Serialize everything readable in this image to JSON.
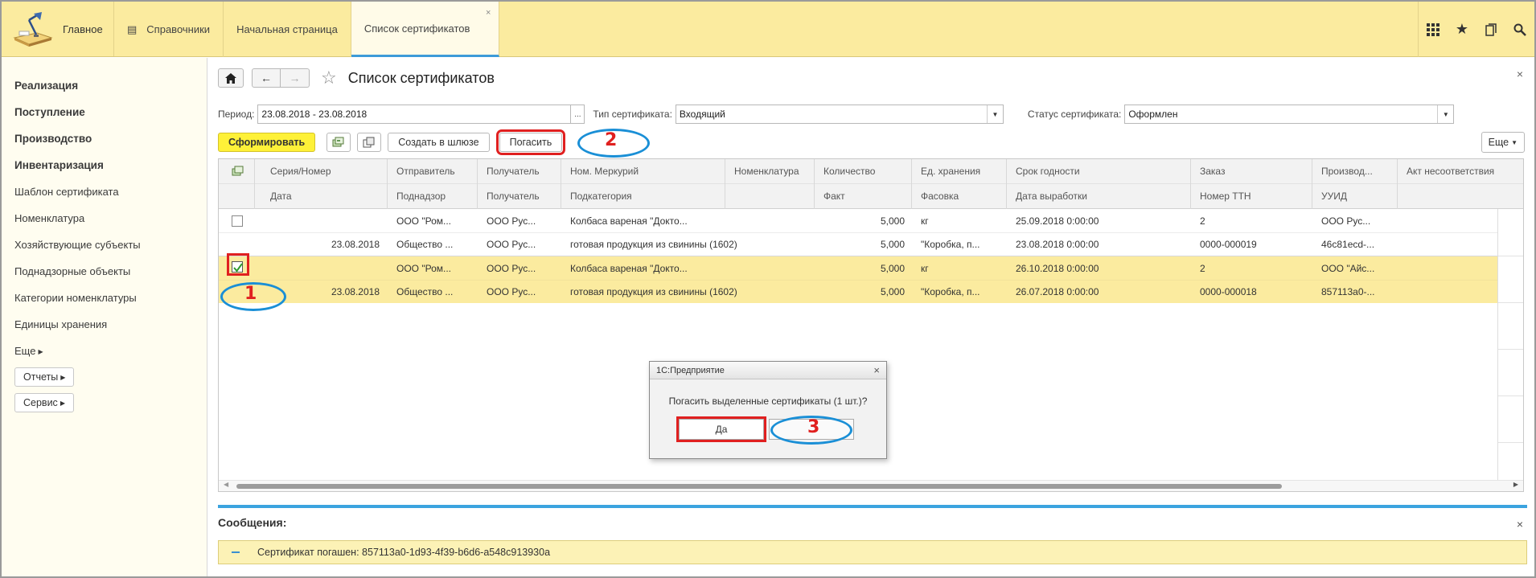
{
  "topbar": {
    "home_label": "Главное",
    "tabs": [
      {
        "label": "Справочники"
      },
      {
        "label": "Начальная страница"
      },
      {
        "label": "Список сертификатов",
        "close": "×"
      }
    ]
  },
  "sidebar": {
    "bold_items": [
      "Реализация",
      "Поступление",
      "Производство",
      "Инвентаризация"
    ],
    "items": [
      "Шаблон сертификата",
      "Номенклатура",
      "Хозяйствующие субъекты",
      "Поднадзорные объекты",
      "Категории номенклатуры",
      "Единицы хранения"
    ],
    "more": "Еще",
    "buttons": [
      "Отчеты",
      "Сервис"
    ]
  },
  "page": {
    "title": "Список сертификатов",
    "close": "×"
  },
  "filters": {
    "period_label": "Период:",
    "period_value": "23.08.2018 - 23.08.2018",
    "period_btn": "...",
    "type_label": "Тип сертификата:",
    "type_value": "Входящий",
    "status_label": "Статус сертификата:",
    "status_value": "Оформлен"
  },
  "toolbar": {
    "form_label": "Сформировать",
    "create_label": "Создать в шлюзе",
    "repay_label": "Погасить",
    "more_label": "Еще"
  },
  "table": {
    "header_row1": [
      "Серия/Номер",
      "Отправитель",
      "Получатель",
      "Ном. Меркурий",
      "Номенклатура",
      "Количество",
      "Ед. хранения",
      "Срок годности",
      "Заказ",
      "Производ...",
      "Акт несоответствия"
    ],
    "header_row2": [
      "Дата",
      "Поднадзор",
      "Получатель",
      "Подкатегория",
      "",
      "Факт",
      "Фасовка",
      "Дата выработки",
      "Номер ТТН",
      "УУИД",
      ""
    ],
    "rows": [
      {
        "line1": [
          "",
          "ООО \"Ром...",
          "ООО Рус...",
          "Колбаса вареная \"Докто...",
          "",
          "5,000",
          "кг",
          "25.09.2018 0:00:00",
          "2",
          "ООО Рус..."
        ],
        "line2": [
          "23.08.2018",
          "Общество ...",
          "ООО Рус...",
          "готовая продукция из свинины (1602)",
          "",
          "5,000",
          "\"Коробка, п...",
          "23.08.2018 0:00:00",
          "0000-000019",
          "46c81ecd-..."
        ]
      },
      {
        "line1": [
          "",
          "ООО \"Ром...",
          "ООО Рус...",
          "Колбаса вареная \"Докто...",
          "",
          "5,000",
          "кг",
          "26.10.2018 0:00:00",
          "2",
          "ООО \"Айс..."
        ],
        "line2": [
          "23.08.2018",
          "Общество ...",
          "ООО Рус...",
          "готовая продукция из свинины (1602)",
          "",
          "5,000",
          "\"Коробка, п...",
          "26.07.2018 0:00:00",
          "0000-000018",
          "857113a0-..."
        ]
      }
    ]
  },
  "messages": {
    "label": "Сообщения:",
    "close": "×",
    "text": "Сертификат погашен: 857113a0-1d93-4f39-b6d6-a548c913930a"
  },
  "dialog": {
    "title": "1С:Предприятие",
    "close": "×",
    "text": "Погасить выделенные сертификаты (1 шт.)?",
    "yes_label": "Да",
    "no_label": ""
  },
  "annotations": {
    "n1": "1",
    "n2": "2",
    "n3": "3"
  },
  "colors": {
    "accent": "#fbeb9f",
    "primary_button": "#fef138",
    "annotation_red": "#e02020",
    "annotation_blue": "#1a8fd6"
  }
}
